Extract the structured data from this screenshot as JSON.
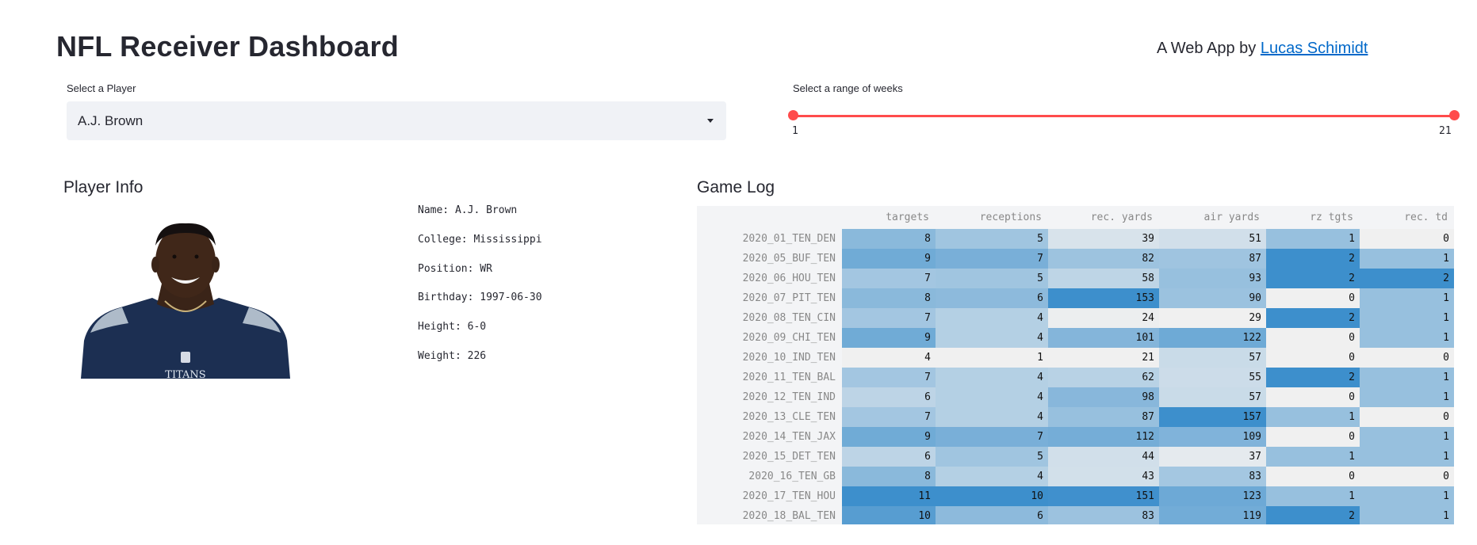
{
  "header": {
    "title": "NFL Receiver Dashboard",
    "byline_prefix": "A Web App by ",
    "byline_link": "Lucas Schimidt"
  },
  "controls": {
    "player_label": "Select a Player",
    "player_value": "A.J. Brown",
    "weeks_label": "Select a range of weeks",
    "weeks_min": "1",
    "weeks_max": "21"
  },
  "player_info": {
    "heading": "Player Info",
    "jersey_text": "TITANS",
    "lines": [
      "Name: A.J. Brown",
      "College: Mississippi",
      "Position: WR",
      "Birthday: 1997-06-30",
      "Height: 6-0",
      "Weight: 226"
    ]
  },
  "game_log": {
    "heading": "Game Log",
    "columns": [
      "targets",
      "receptions",
      "rec. yards",
      "air yards",
      "rz tgts",
      "rec. td"
    ],
    "rows": [
      {
        "game": "2020_01_TEN_DEN",
        "values": [
          8,
          5,
          39,
          51,
          1,
          0
        ]
      },
      {
        "game": "2020_05_BUF_TEN",
        "values": [
          9,
          7,
          82,
          87,
          2,
          1
        ]
      },
      {
        "game": "2020_06_HOU_TEN",
        "values": [
          7,
          5,
          58,
          93,
          2,
          2
        ]
      },
      {
        "game": "2020_07_PIT_TEN",
        "values": [
          8,
          6,
          153,
          90,
          0,
          1
        ]
      },
      {
        "game": "2020_08_TEN_CIN",
        "values": [
          7,
          4,
          24,
          29,
          2,
          1
        ]
      },
      {
        "game": "2020_09_CHI_TEN",
        "values": [
          9,
          4,
          101,
          122,
          0,
          1
        ]
      },
      {
        "game": "2020_10_IND_TEN",
        "values": [
          4,
          1,
          21,
          57,
          0,
          0
        ]
      },
      {
        "game": "2020_11_TEN_BAL",
        "values": [
          7,
          4,
          62,
          55,
          2,
          1
        ]
      },
      {
        "game": "2020_12_TEN_IND",
        "values": [
          6,
          4,
          98,
          57,
          0,
          1
        ]
      },
      {
        "game": "2020_13_CLE_TEN",
        "values": [
          7,
          4,
          87,
          157,
          1,
          0
        ]
      },
      {
        "game": "2020_14_TEN_JAX",
        "values": [
          9,
          7,
          112,
          109,
          0,
          1
        ]
      },
      {
        "game": "2020_15_DET_TEN",
        "values": [
          6,
          5,
          44,
          37,
          1,
          1
        ]
      },
      {
        "game": "2020_16_TEN_GB",
        "values": [
          8,
          4,
          43,
          83,
          0,
          0
        ]
      },
      {
        "game": "2020_17_TEN_HOU",
        "values": [
          11,
          10,
          151,
          123,
          1,
          1
        ]
      },
      {
        "game": "2020_18_BAL_TEN",
        "values": [
          10,
          6,
          83,
          119,
          2,
          1
        ]
      }
    ]
  },
  "colors": {
    "accent": "#ff4b4b",
    "link": "#0068c9",
    "heat_low": "#f0f0f0",
    "heat_high": "#3d8fcc"
  }
}
